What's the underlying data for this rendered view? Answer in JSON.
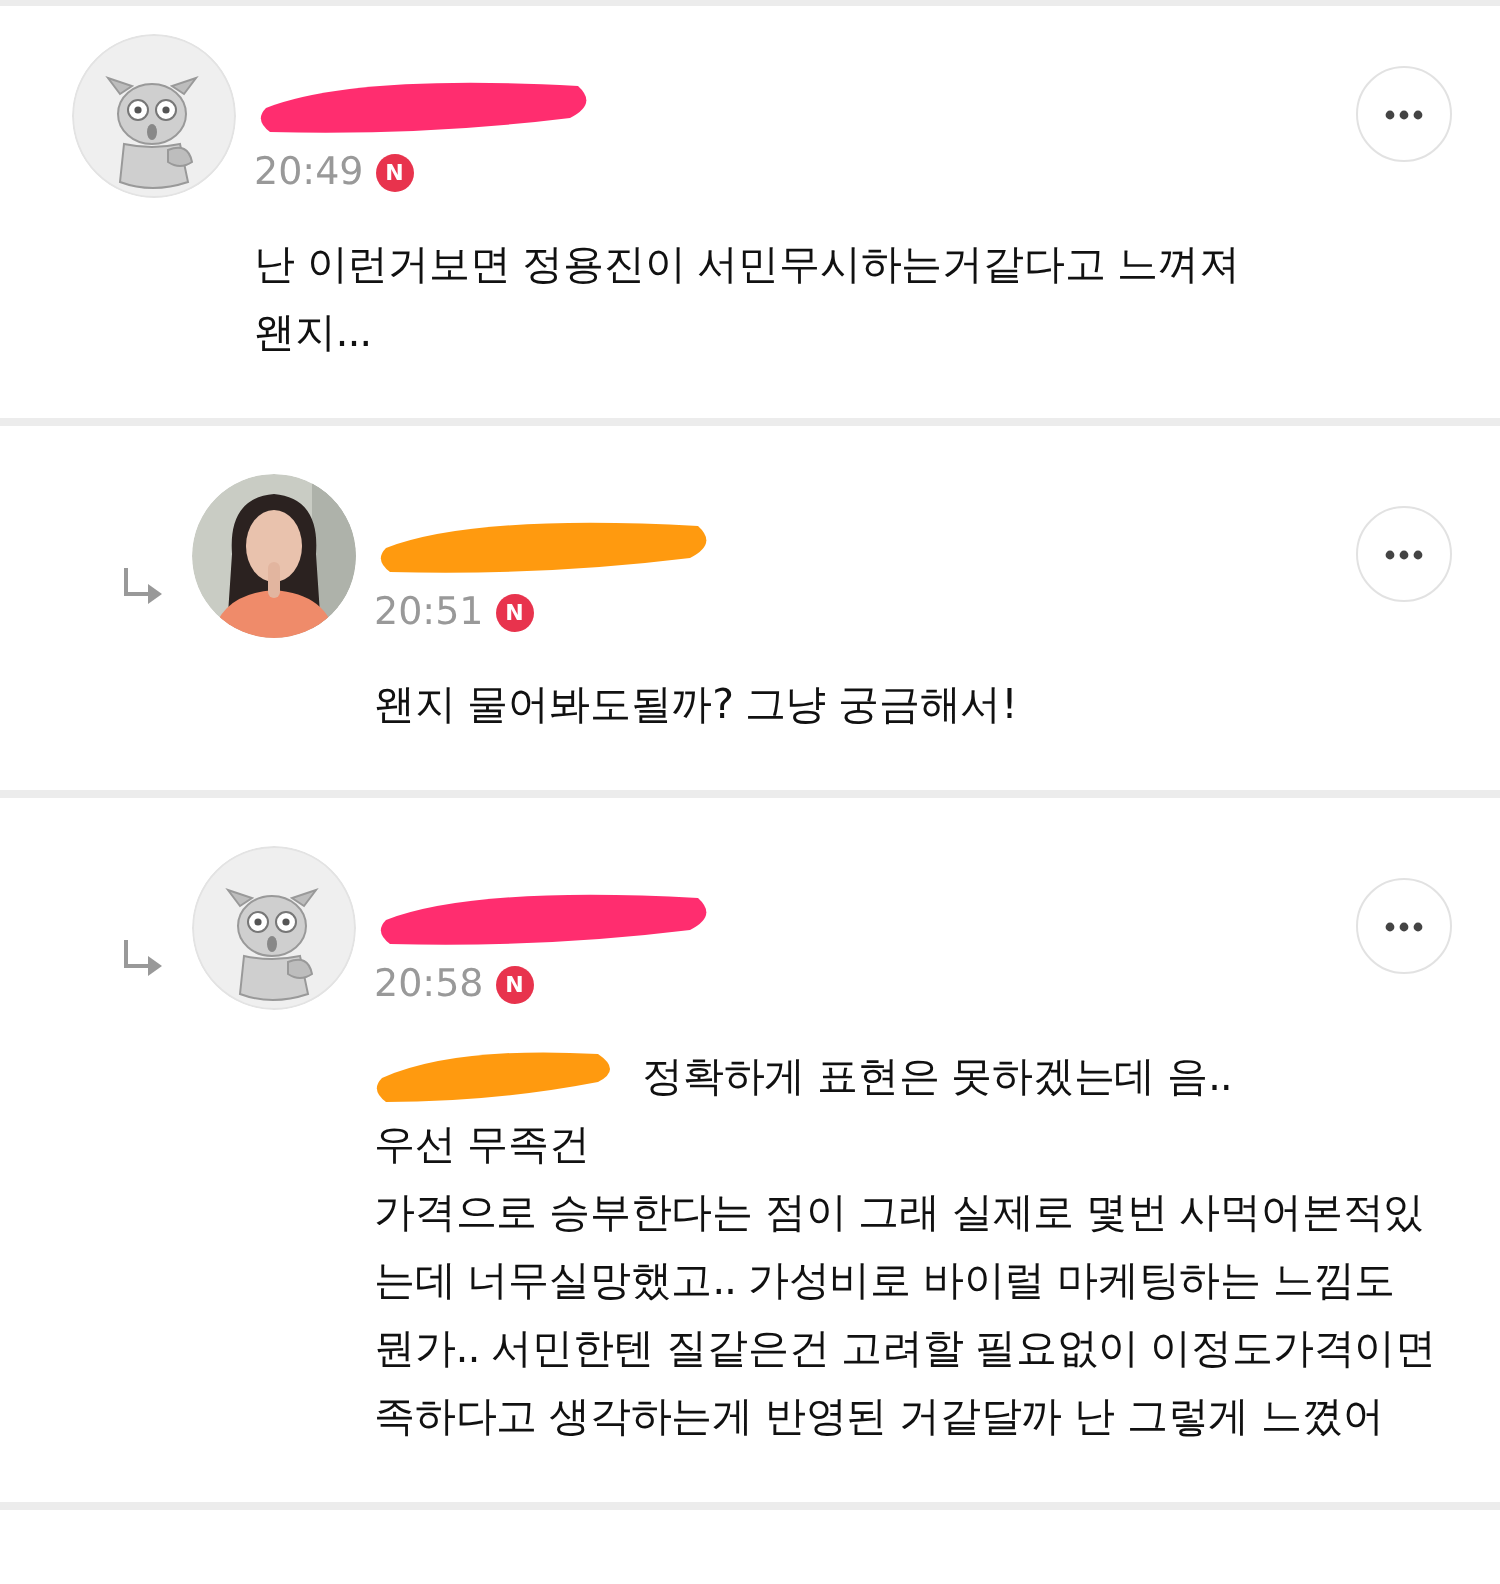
{
  "comments": [
    {
      "reply": false,
      "avatar": {
        "kind": "dog"
      },
      "name_redaction": {
        "color": "#ff2d6f"
      },
      "time": "20:49",
      "new_badge": "N",
      "body": "난 이런거보면 정용진이 서민무시하는거같다고 느껴져\n왠지..."
    },
    {
      "reply": true,
      "name_redaction": {
        "color": "#ff9a0f"
      },
      "time": "20:51",
      "new_badge": "N",
      "body": "왠지 물어봐도될까? 그냥 궁금해서!"
    },
    {
      "reply": true,
      "avatar": {
        "kind": "dog"
      },
      "name_redaction": {
        "color": "#ff2d6f"
      },
      "time": "20:58",
      "new_badge": "N",
      "mention_redaction": {
        "color": "#ff9a0f"
      },
      "body": "정확하게 표현은 못하겠는데 음..\n우선 무족건\n가격으로 승부한다는 점이 그래 실제로 몇번 사먹어본적있는데 너무실망했고.. 가성비로 바이럴 마케팅하는 느낌도 뭔가.. 서민한텐 질같은건 고려할 필요없이 이정도가격이면 족하다고 생각하는게 반영된 거같달까 난 그렇게 느꼈어"
    }
  ]
}
